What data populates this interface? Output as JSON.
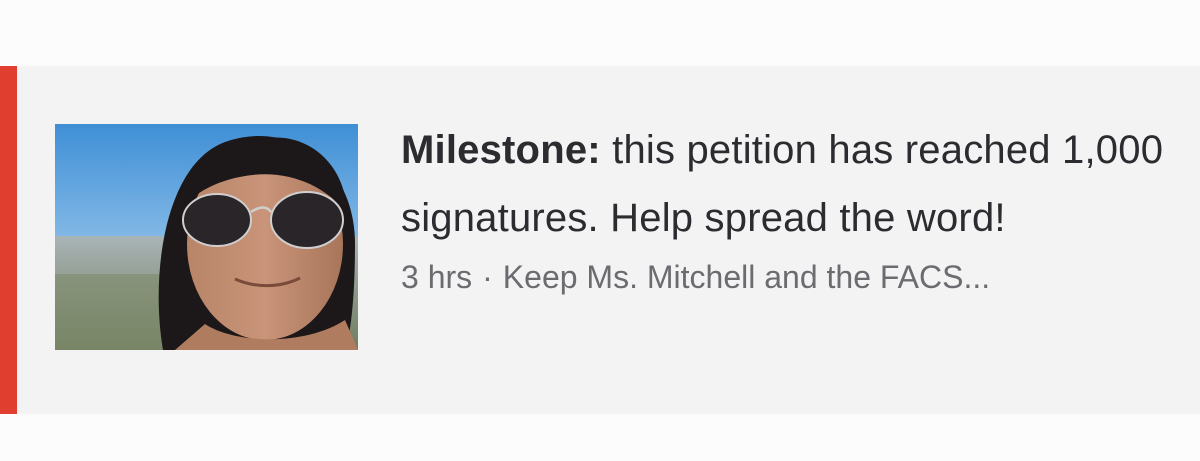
{
  "update": {
    "headline_lead": "Milestone:",
    "headline_text": "this petition has reached 1,000 signatures. Help spread the word!",
    "time_ago": "3 hrs",
    "separator": "·",
    "petition_title": "Keep Ms. Mitchell and the FACS..."
  },
  "colors": {
    "accent": "#e03e2f",
    "card_background": "#f4f3f4",
    "headline_text": "#2b2b30",
    "meta_text": "#6b6b70"
  }
}
